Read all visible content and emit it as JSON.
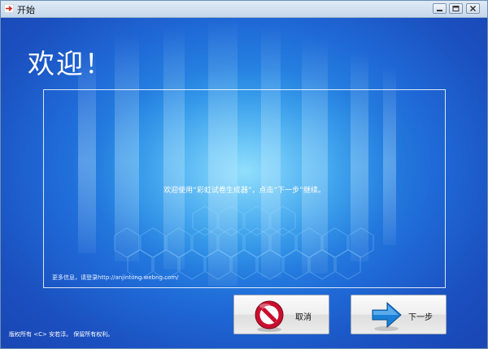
{
  "window": {
    "title": "开始"
  },
  "main": {
    "heading": "欢迎！",
    "message": "欢迎使用“彩虹试卷生成器”，点击“下一步”继续。",
    "more_info": "更多信息，请登录http://anjintong.webng.com/",
    "copyright": "版权所有 <C> 安若淳。 保留所有权利。"
  },
  "buttons": {
    "cancel_label": "取消",
    "next_label": "下一步"
  },
  "icons": {
    "app": "app-arrow-icon",
    "cancel": "stop-sign-icon",
    "next": "arrow-right-icon"
  },
  "colors": {
    "background": "#1b56c9",
    "glow": "#4fb8f5",
    "stop_red": "#c8102e",
    "arrow_blue": "#1a7fd6"
  }
}
